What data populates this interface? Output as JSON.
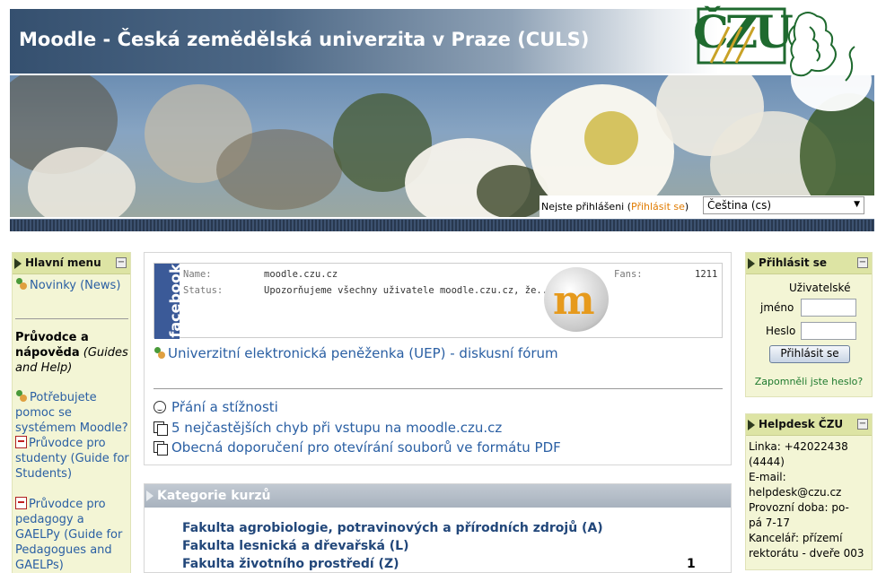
{
  "header": {
    "title": "Moodle - Česká zemědělská univerzita v Praze (CULS)",
    "logo_text": "ČZU"
  },
  "topbar": {
    "login_prefix": "Nejste přihlášeni (",
    "login_link": "Přihlásit se",
    "login_suffix": ")",
    "language": "Čeština (cs)"
  },
  "main_menu": {
    "title": "Hlavní menu",
    "minimize": "−",
    "news": "Novinky (News)",
    "guide_heading": "Průvodce a nápověda",
    "guide_heading_en": "(Guides and Help)",
    "items": [
      "Potřebujete pomoc se systémem Moodle?",
      "Průvodce pro studenty (Guide for Students)",
      "Průvodce pro pedagogy a GAELPy (Guide for Pedagogues and GAELPs)"
    ]
  },
  "facebook": {
    "brand": "facebook",
    "name_label": "Name:",
    "name_value": "moodle.czu.cz",
    "status_label": "Status:",
    "status_value": "Upozorňujeme všechny uživatele moodle.czu.cz, že...",
    "fans_label": "Fans:",
    "fans_value": "1211"
  },
  "main_links": {
    "uep": "Univerzitní elektronická peněženka (UEP) - diskusní fórum",
    "wishes": "Přání a stížnosti",
    "errors": "5 nejčastějších chyb při vstupu na moodle.czu.cz",
    "pdf": "Obecná doporučení pro otevírání souborů ve formátu PDF"
  },
  "categories": {
    "title": "Kategorie kurzů",
    "items": [
      {
        "name": "Fakulta agrobiologie, potravinových a přírodních zdrojů (A)",
        "count": ""
      },
      {
        "name": "Fakulta lesnická a dřevařská (L)",
        "count": ""
      },
      {
        "name": "Fakulta životního prostředí (Z)",
        "count": "1"
      }
    ]
  },
  "login_block": {
    "title": "Přihlásit se",
    "minimize": "−",
    "username_label_1": "Uživatelské",
    "username_label_2": "jméno",
    "password_label": "Heslo",
    "submit": "Přihlásit se",
    "forgot": "Zapomněli jste heslo?"
  },
  "helpdesk": {
    "title": "Helpdesk ČZU",
    "minimize": "−",
    "lines": [
      "Linka: +42022438",
      "(4444)",
      "E-mail:",
      "helpdesk@czu.cz",
      "Provozní doba: po-",
      "pá 7-17",
      "Kancelář: přízemí",
      "rektorátu - dveře 003"
    ]
  }
}
